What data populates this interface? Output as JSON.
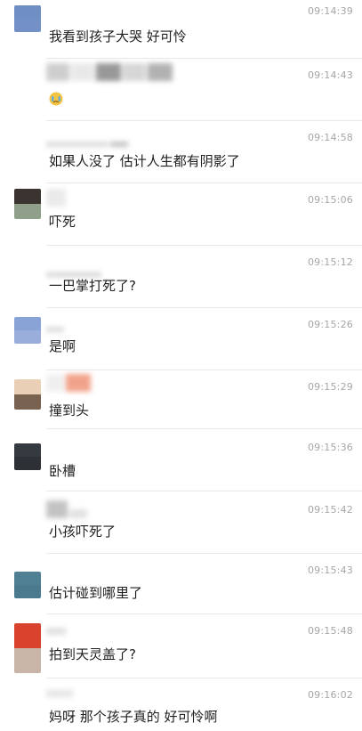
{
  "colors": {
    "divider": "#e9e9e9",
    "time": "#a6a6a6",
    "text": "#1f1f1f"
  },
  "messages": [
    {
      "time": "09:14:39",
      "text": "我看到孩子大哭 好可怜",
      "avatar": [
        "#6f8fc4",
        "#7391c6"
      ]
    },
    {
      "time": "09:14:43",
      "text": "",
      "emoji": "crying-face-emoji",
      "avatar": null
    },
    {
      "time": "09:14:58",
      "text": "如果人没了 估计人生都有阴影了",
      "avatar": null
    },
    {
      "time": "09:15:06",
      "text": "吓死",
      "avatar": [
        "#3a3330",
        "#8f9f8a"
      ]
    },
    {
      "time": "09:15:12",
      "text": "一巴掌打死了?",
      "avatar": null
    },
    {
      "time": "09:15:26",
      "text": "是啊",
      "avatar": [
        "#8aa3d6",
        "#9aaedb"
      ]
    },
    {
      "time": "09:15:29",
      "text": "撞到头",
      "avatar": [
        "#e9cfb5",
        "#7a6250"
      ]
    },
    {
      "time": "09:15:36",
      "text": "卧槽",
      "avatar": [
        "#353a40",
        "#2d3136"
      ]
    },
    {
      "time": "09:15:42",
      "text": "小孩吓死了",
      "avatar": null
    },
    {
      "time": "09:15:43",
      "text": "估计碰到哪里了",
      "avatar": [
        "#4f7f92",
        "#4b7a8e"
      ]
    },
    {
      "time": "09:15:48",
      "text": "拍到天灵盖了?",
      "avatar": [
        "#d9432e",
        "#c9b4a8"
      ]
    },
    {
      "time": "09:16:02",
      "text": "妈呀 那个孩子真的 好可怜啊",
      "avatar": null
    }
  ]
}
